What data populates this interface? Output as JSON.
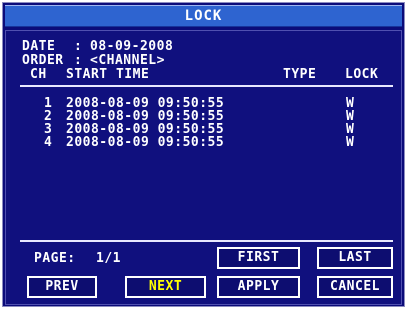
{
  "window": {
    "title": "LOCK"
  },
  "info": {
    "date_label": "DATE",
    "date_value": "08-09-2008",
    "order_label": "ORDER",
    "order_value": "<CHANNEL>"
  },
  "table": {
    "headers": {
      "ch": "CH",
      "start_time": "START TIME",
      "type": "TYPE",
      "lock": "LOCK"
    },
    "rows": [
      {
        "ch": "1",
        "start_time": "2008-08-09 09:50:55",
        "type": "",
        "lock": "W"
      },
      {
        "ch": "2",
        "start_time": "2008-08-09 09:50:55",
        "type": "",
        "lock": "W"
      },
      {
        "ch": "3",
        "start_time": "2008-08-09 09:50:55",
        "type": "",
        "lock": "W"
      },
      {
        "ch": "4",
        "start_time": "2008-08-09 09:50:55",
        "type": "",
        "lock": "W"
      }
    ]
  },
  "footer": {
    "page_label": "PAGE:",
    "page_value": "1/1",
    "buttons": {
      "first": "FIRST",
      "last": "LAST",
      "prev": "PREV",
      "next": "NEXT",
      "apply": "APPLY",
      "cancel": "CANCEL"
    }
  },
  "colors": {
    "background": "#0b0b79",
    "title_bar": "#2e64d0",
    "text": "#ffffff",
    "highlight_text": "#ffff00"
  }
}
